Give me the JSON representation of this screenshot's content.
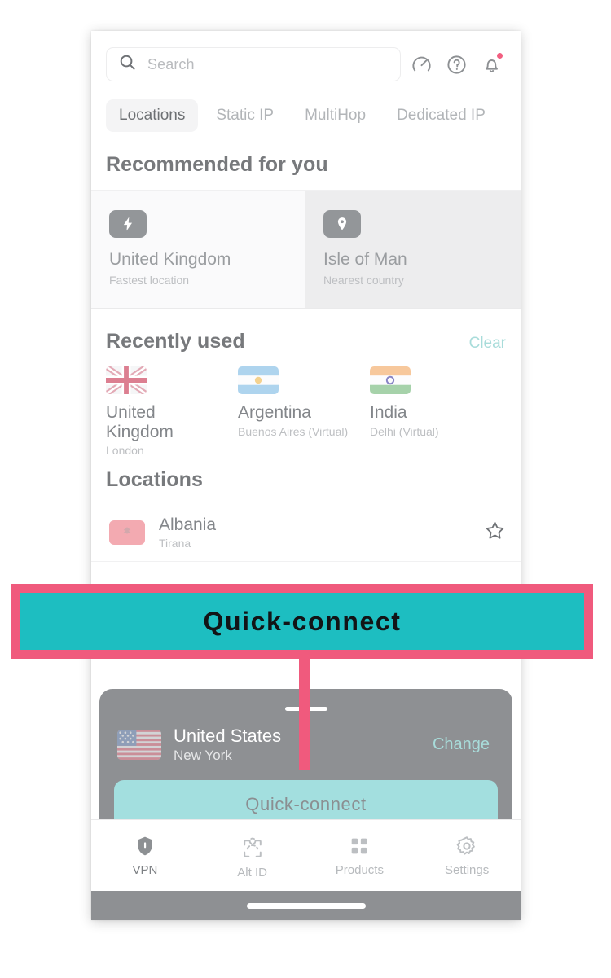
{
  "search": {
    "placeholder": "Search",
    "icon": "search-icon"
  },
  "header_icons": [
    {
      "name": "speed-test-icon"
    },
    {
      "name": "help-icon"
    },
    {
      "name": "notifications-bell-icon",
      "badge": true
    }
  ],
  "tabs": [
    {
      "label": "Locations",
      "active": true
    },
    {
      "label": "Static IP",
      "active": false
    },
    {
      "label": "MultiHop",
      "active": false
    },
    {
      "label": "Dedicated IP",
      "active": false
    }
  ],
  "recommended": {
    "title": "Recommended for you",
    "cards": [
      {
        "name": "United Kingdom",
        "subtitle": "Fastest location",
        "icon": "lightning-bolt-icon"
      },
      {
        "name": "Isle of Man",
        "subtitle": "Nearest country",
        "icon": "map-pin-icon"
      }
    ]
  },
  "recently_used": {
    "title": "Recently used",
    "clear_label": "Clear",
    "items": [
      {
        "name": "United Kingdom",
        "subtitle": "London",
        "flag": "flag-uk"
      },
      {
        "name": "Argentina",
        "subtitle": "Buenos Aires (Virtual)",
        "flag": "flag-argentina"
      },
      {
        "name": "India",
        "subtitle": "Delhi (Virtual)",
        "flag": "flag-india"
      }
    ]
  },
  "locations": {
    "title": "Locations",
    "rows": [
      {
        "name": "Albania",
        "subtitle": "Tirana",
        "flag": "flag-albania",
        "favorite": false
      }
    ]
  },
  "sheet": {
    "country": "United States",
    "city": "New York",
    "flag": "flag-usa",
    "change_label": "Change",
    "quick_connect_label": "Quick-connect"
  },
  "tabbar": [
    {
      "label": "VPN",
      "icon": "shield-icon",
      "active": true
    },
    {
      "label": "Alt ID",
      "icon": "face-id-icon",
      "active": false
    },
    {
      "label": "Products",
      "icon": "grid-icon",
      "active": false
    },
    {
      "label": "Settings",
      "icon": "gear-icon",
      "active": false
    }
  ],
  "annotation": {
    "label": "Quick-connect",
    "fill_color": "#1DBEC1",
    "border_color": "#F05A7D"
  }
}
